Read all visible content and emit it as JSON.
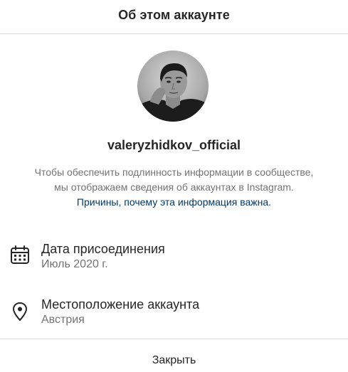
{
  "dialog": {
    "title": "Об этом аккаунте"
  },
  "profile": {
    "username": "valeryzhidkov_official",
    "avatar": "profile-photo"
  },
  "explanation": {
    "line1": "Чтобы обеспечить подлинность информации в сообществе,",
    "line2": "мы отображаем сведения об аккаунтах в Instagram.",
    "link": "Причины, почему эта информация важна."
  },
  "details": [
    {
      "icon": "calendar-icon",
      "title": "Дата присоединения",
      "value": "Июль 2020 г."
    },
    {
      "icon": "location-pin-icon",
      "title": "Местоположение аккаунта",
      "value": "Австрия"
    }
  ],
  "footer": {
    "close_label": "Закрыть"
  },
  "colors": {
    "text": "#262626",
    "secondary_text": "#737373",
    "link": "#00376b",
    "divider": "#dbdbdb"
  }
}
